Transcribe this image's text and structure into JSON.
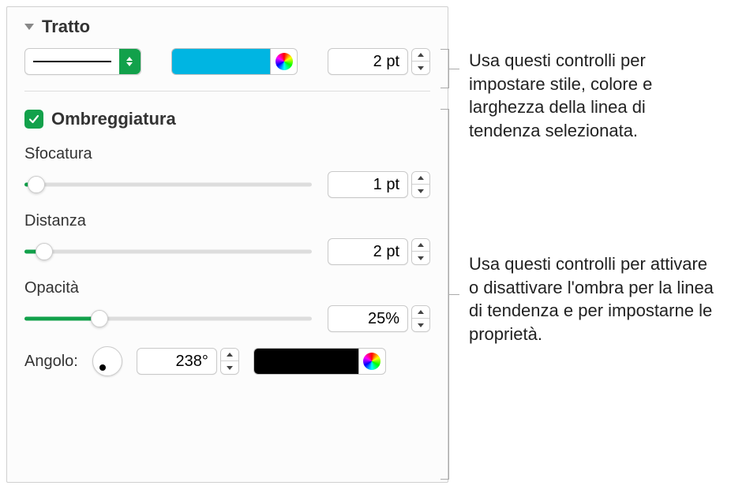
{
  "stroke": {
    "title": "Tratto",
    "color": "#00b5e2",
    "width_value": "2 pt"
  },
  "shadow": {
    "label": "Ombreggiatura",
    "checked": true,
    "blur": {
      "label": "Sfocatura",
      "value": "1 pt",
      "percent": 4
    },
    "offset": {
      "label": "Distanza",
      "value": "2 pt",
      "percent": 7
    },
    "opacity": {
      "label": "Opacità",
      "value": "25%",
      "percent": 26
    },
    "angle": {
      "label": "Angolo:",
      "value": "238°"
    },
    "color": "#000000"
  },
  "callouts": {
    "stroke": "Usa questi controlli per impostare stile, colore e larghezza della linea di tendenza selezionata.",
    "shadow": "Usa questi controlli per attivare o disattivare l'ombra per la linea di tendenza e per impostarne le proprietà."
  }
}
